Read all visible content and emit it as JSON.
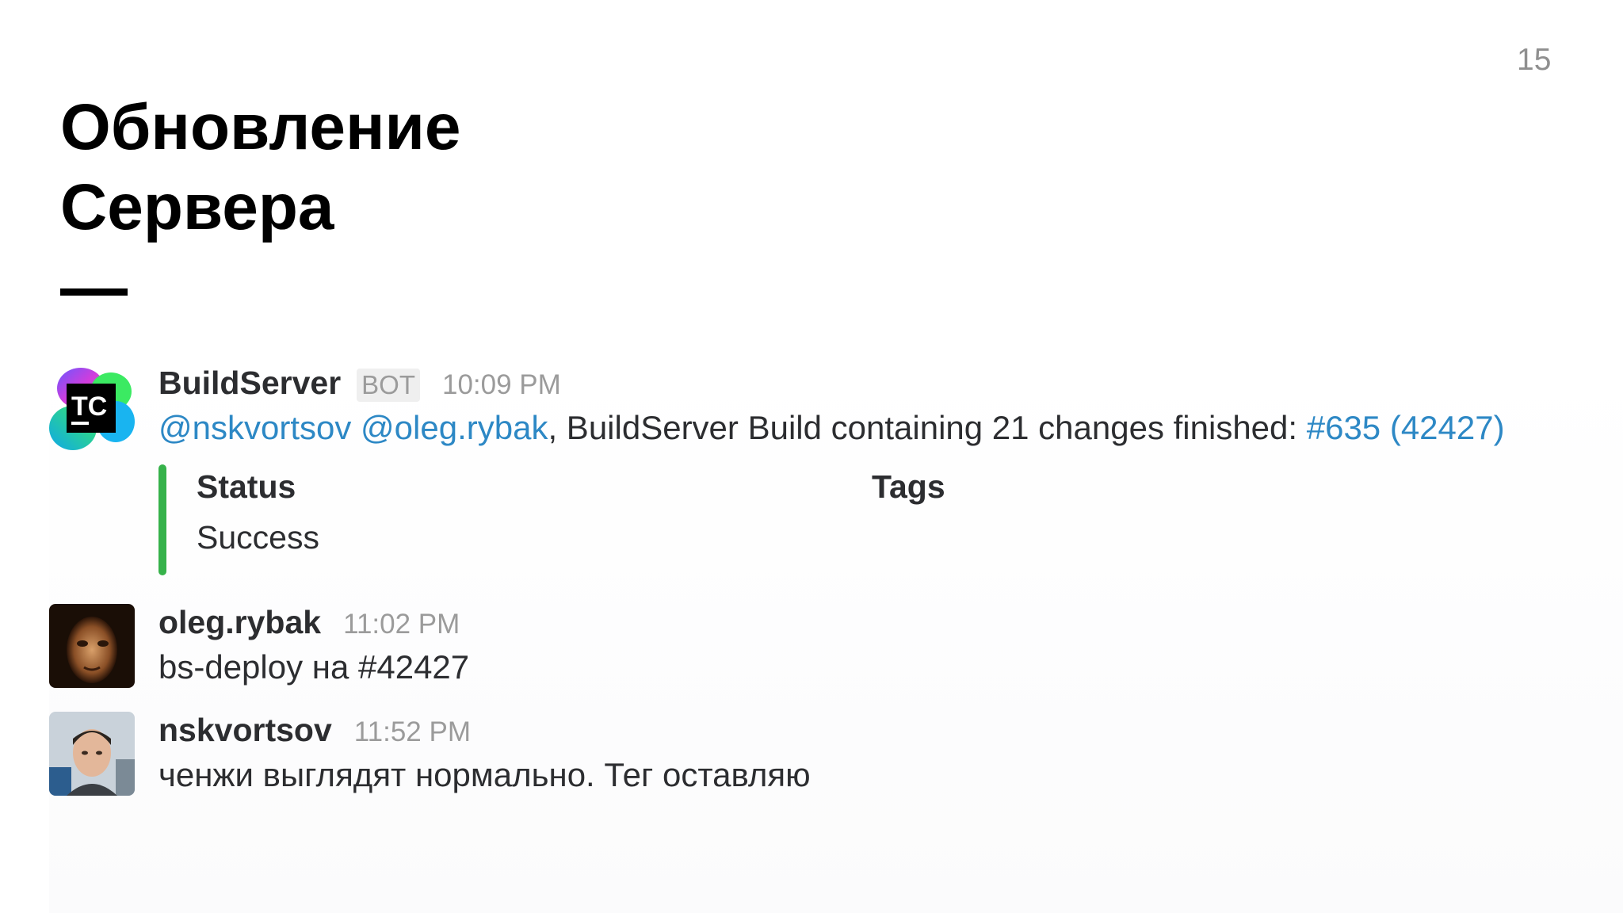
{
  "slide": {
    "number": "15",
    "title_line1": "Обновление",
    "title_line2": "Сервера"
  },
  "messages": [
    {
      "sender": "BuildServer",
      "badge": "BOT",
      "time": "10:09 PM",
      "avatar_label": "TC",
      "mention_1": "@nskvortsov",
      "mention_2": "@oleg.rybak",
      "text": ", BuildServer Build containing 21 changes finished: ",
      "link": "#635 (42427)",
      "attachment": {
        "accent_color": "#36b24a",
        "fields": [
          {
            "title": "Status",
            "value": "Success"
          },
          {
            "title": "Tags",
            "value": ""
          }
        ]
      }
    },
    {
      "sender": "oleg.rybak",
      "time": "11:02 PM",
      "text": "bs-deploy на #42427"
    },
    {
      "sender": "nskvortsov",
      "time": "11:52 PM",
      "text": "ченжи выглядят нормально. Тег оставляю"
    }
  ],
  "colors": {
    "link": "#2d88c5",
    "text": "#2c2d30",
    "muted": "#9b9b9b"
  }
}
